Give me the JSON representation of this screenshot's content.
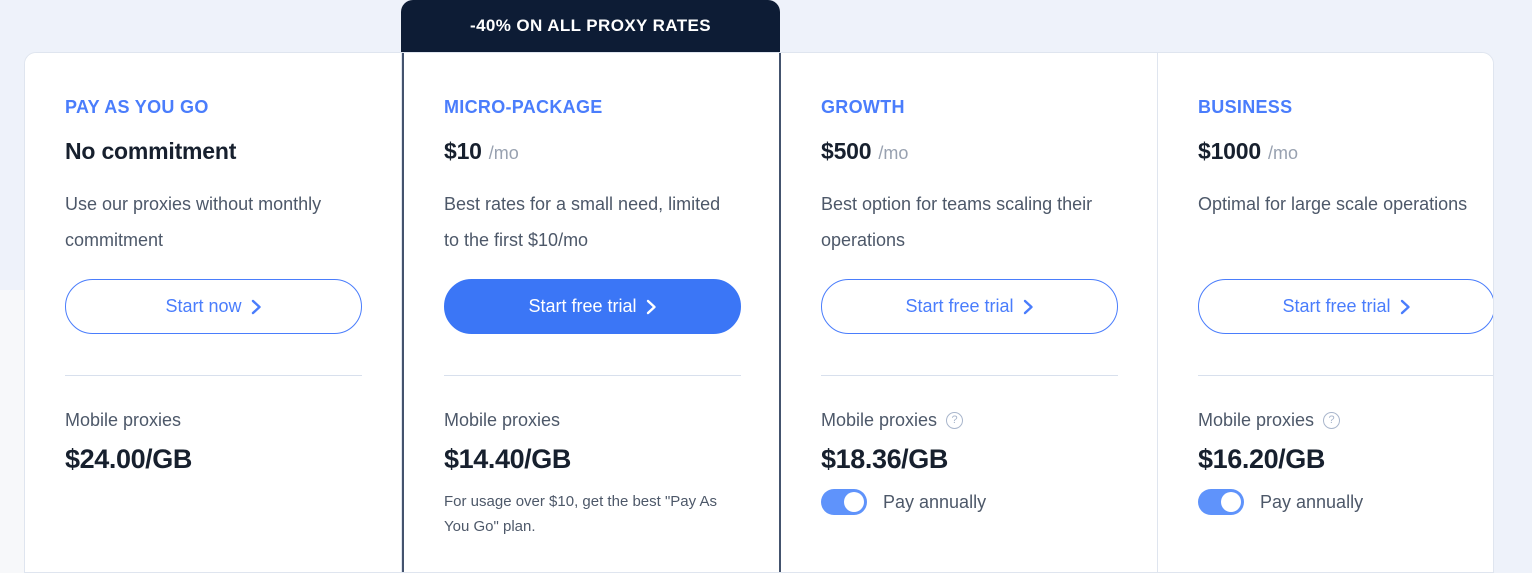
{
  "promo": {
    "badge_text": "-40% ON ALL PROXY RATES"
  },
  "colors": {
    "accent_blue": "#4a7dfc",
    "solid_button_blue": "#3b76f6",
    "badge_navy": "#0d1c35",
    "toggle_on": "#5f93fb",
    "page_background": "#eef2fa"
  },
  "plans": [
    {
      "name": "PAY AS YOU GO",
      "price": "No commitment",
      "price_period": "",
      "description": "Use our proxies without monthly commitment",
      "cta_label": "Start now",
      "cta_style": "outline",
      "feature_label": "Mobile proxies",
      "has_help_icon": false,
      "help_icon_glyph": "?",
      "feature_rate": "$24.00/GB",
      "feature_note": "",
      "has_annual_toggle": false,
      "annual_label": "",
      "featured": false
    },
    {
      "name": "MICRO-PACKAGE",
      "price": "$10",
      "price_period": "/mo",
      "description": "Best rates for a small need, limited to the first $10/mo",
      "cta_label": "Start free trial",
      "cta_style": "solid",
      "feature_label": "Mobile proxies",
      "has_help_icon": false,
      "help_icon_glyph": "?",
      "feature_rate": "$14.40/GB",
      "feature_note": "For usage over $10, get the best \"Pay As You Go\" plan.",
      "has_annual_toggle": false,
      "annual_label": "",
      "featured": true
    },
    {
      "name": "GROWTH",
      "price": "$500",
      "price_period": "/mo",
      "description": "Best option for teams scaling their operations",
      "cta_label": "Start free trial",
      "cta_style": "outline",
      "feature_label": "Mobile proxies",
      "has_help_icon": true,
      "help_icon_glyph": "?",
      "feature_rate": "$18.36/GB",
      "feature_note": "",
      "has_annual_toggle": true,
      "annual_label": "Pay annually",
      "featured": false
    },
    {
      "name": "BUSINESS",
      "price": "$1000",
      "price_period": "/mo",
      "description": "Optimal for large scale operations",
      "cta_label": "Start free trial",
      "cta_style": "outline",
      "feature_label": "Mobile proxies",
      "has_help_icon": true,
      "help_icon_glyph": "?",
      "feature_rate": "$16.20/GB",
      "feature_note": "",
      "has_annual_toggle": true,
      "annual_label": "Pay annually",
      "featured": false
    }
  ]
}
